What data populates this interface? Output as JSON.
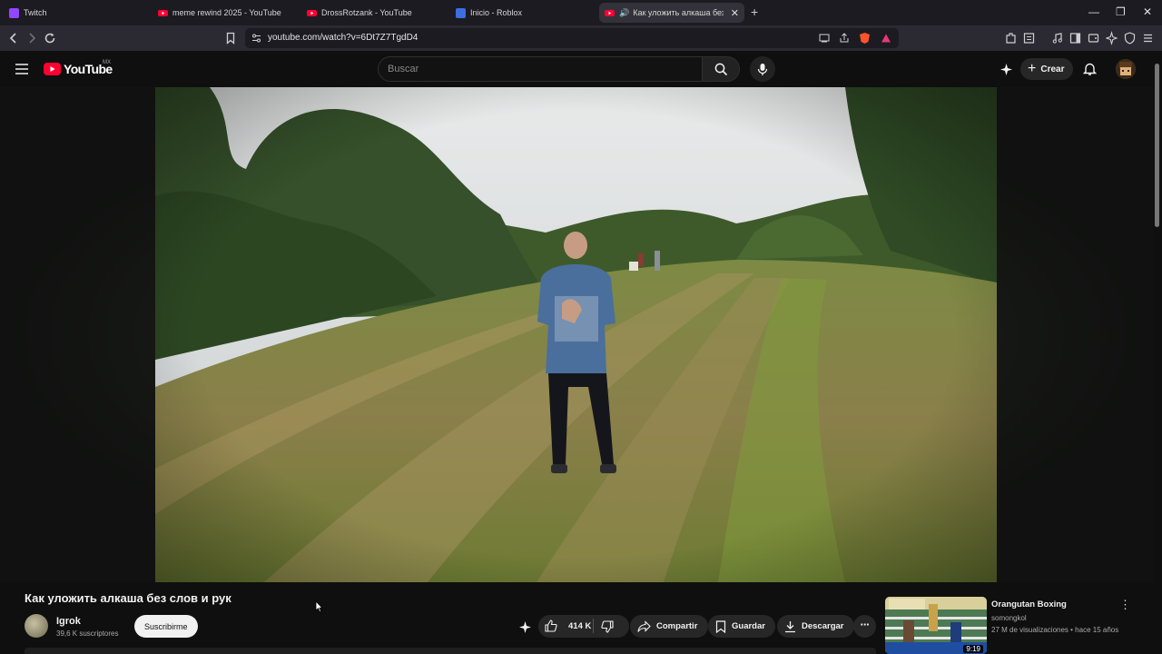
{
  "browser": {
    "tabs": [
      {
        "label": "Twitch",
        "icon": "twitch-icon",
        "color": "#9146ff"
      },
      {
        "label": "meme rewind 2025 - YouTube",
        "icon": "youtube-icon",
        "color": "#ff0033"
      },
      {
        "label": "DrossRotzank - YouTube",
        "icon": "youtube-icon",
        "color": "#ff0033"
      },
      {
        "label": "Inicio - Roblox",
        "icon": "roblox-icon",
        "color": "#3d6de0"
      },
      {
        "label": "Как уложить алкаша без сло",
        "icon": "youtube-icon",
        "color": "#ff0033",
        "active": true
      }
    ],
    "address": "youtube.com/watch?v=6Dt7Z7TgdD4"
  },
  "youtube": {
    "logo_text": "YouTube",
    "country_code": "MX",
    "search_placeholder": "Buscar",
    "create_label": "Crear",
    "brand_color": "#ff0033"
  },
  "video": {
    "title": "Как уложить алкаша без слов и рук",
    "channel_name": "Igrok",
    "subscribers": "39,6 K suscriptores",
    "subscribe_label": "Suscribirme",
    "likes": "414 K",
    "share_label": "Compartir",
    "save_label": "Guardar",
    "download_label": "Descargar"
  },
  "recommended": [
    {
      "title": "Orangutan Boxing",
      "channel": "somongkol",
      "meta": "27 M de visualizaciones • hace 15 años",
      "duration": "9:19"
    }
  ]
}
